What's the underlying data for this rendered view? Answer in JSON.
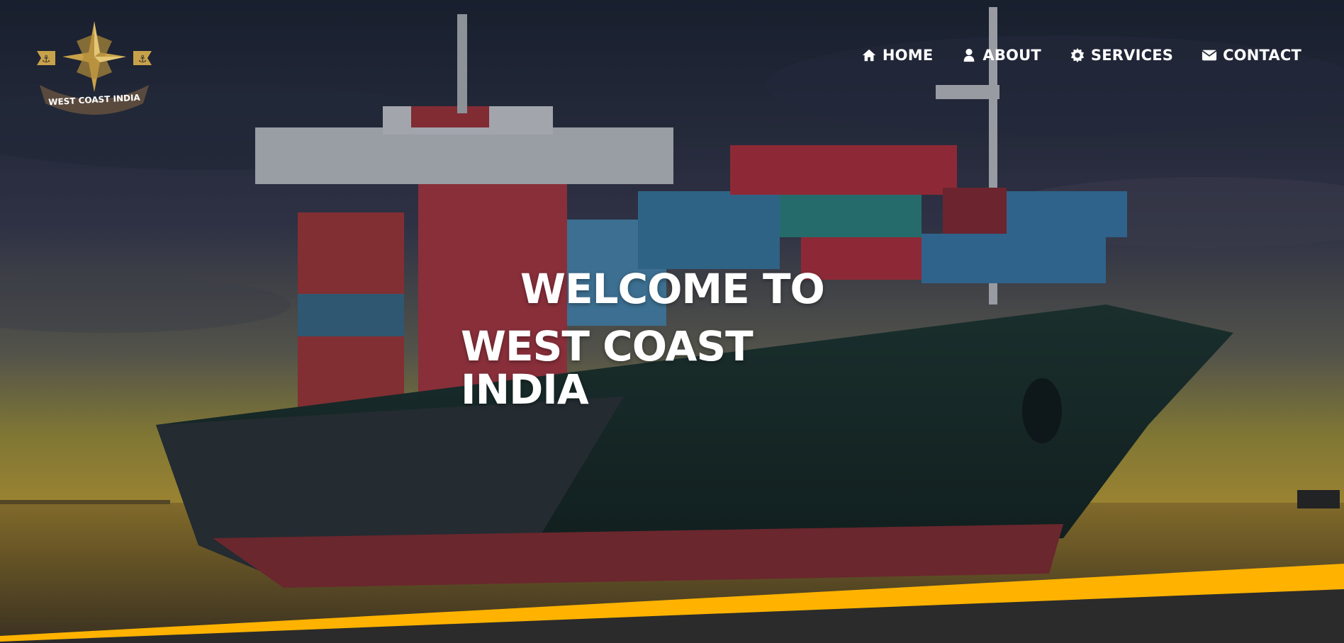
{
  "brand": {
    "logo_text": "WEST COAST INDIA",
    "logo_icon": "compass-star-icon",
    "accent_color": "#c8a24a"
  },
  "nav": {
    "items": [
      {
        "label": "HOME",
        "icon": "home-icon"
      },
      {
        "label": "ABOUT",
        "icon": "user-icon"
      },
      {
        "label": "SERVICES",
        "icon": "gear-icon"
      },
      {
        "label": "CONTACT",
        "icon": "envelope-icon"
      }
    ]
  },
  "hero": {
    "line1": "WELCOME TO",
    "line2": "WEST COAST INDIA",
    "band_color": "#ffb300",
    "footer_color": "#2b2b2b"
  }
}
